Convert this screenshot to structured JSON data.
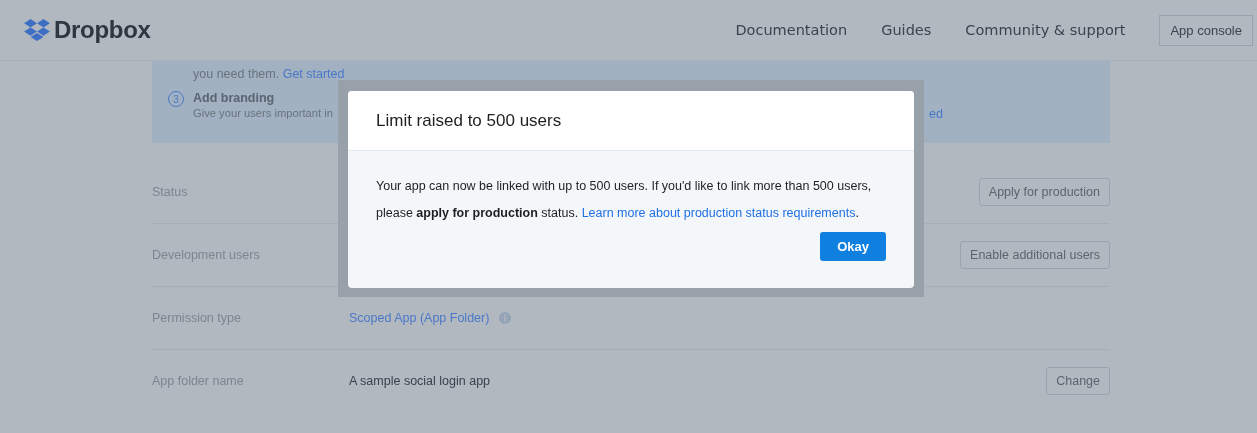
{
  "header": {
    "logo": "Dropbox",
    "nav": [
      "Documentation",
      "Guides",
      "Community & support"
    ],
    "console_button": "App console"
  },
  "banner": {
    "intro_text": "you need them.",
    "intro_link": "Get started",
    "step_number": "3",
    "step_title": "Add branding",
    "step_text": "Give your users important in",
    "cut_link": "ed"
  },
  "rows": [
    {
      "label": "Status",
      "kind": "button",
      "button": "Apply for production"
    },
    {
      "label": "Development users",
      "kind": "button",
      "button": "Enable additional users"
    },
    {
      "label": "Permission type",
      "kind": "link",
      "value": "Scoped App (App Folder)"
    },
    {
      "label": "App folder name",
      "kind": "value",
      "value": "A sample social login app",
      "button": "Change"
    }
  ],
  "modal": {
    "title": "Limit raised to 500 users",
    "message": "Your app can now be linked with up to 500 users. If you'd like to link more than 500 users, please **apply for production** status.",
    "link": "Learn more about production status requirements",
    "after_link": ".",
    "button": "Okay"
  }
}
